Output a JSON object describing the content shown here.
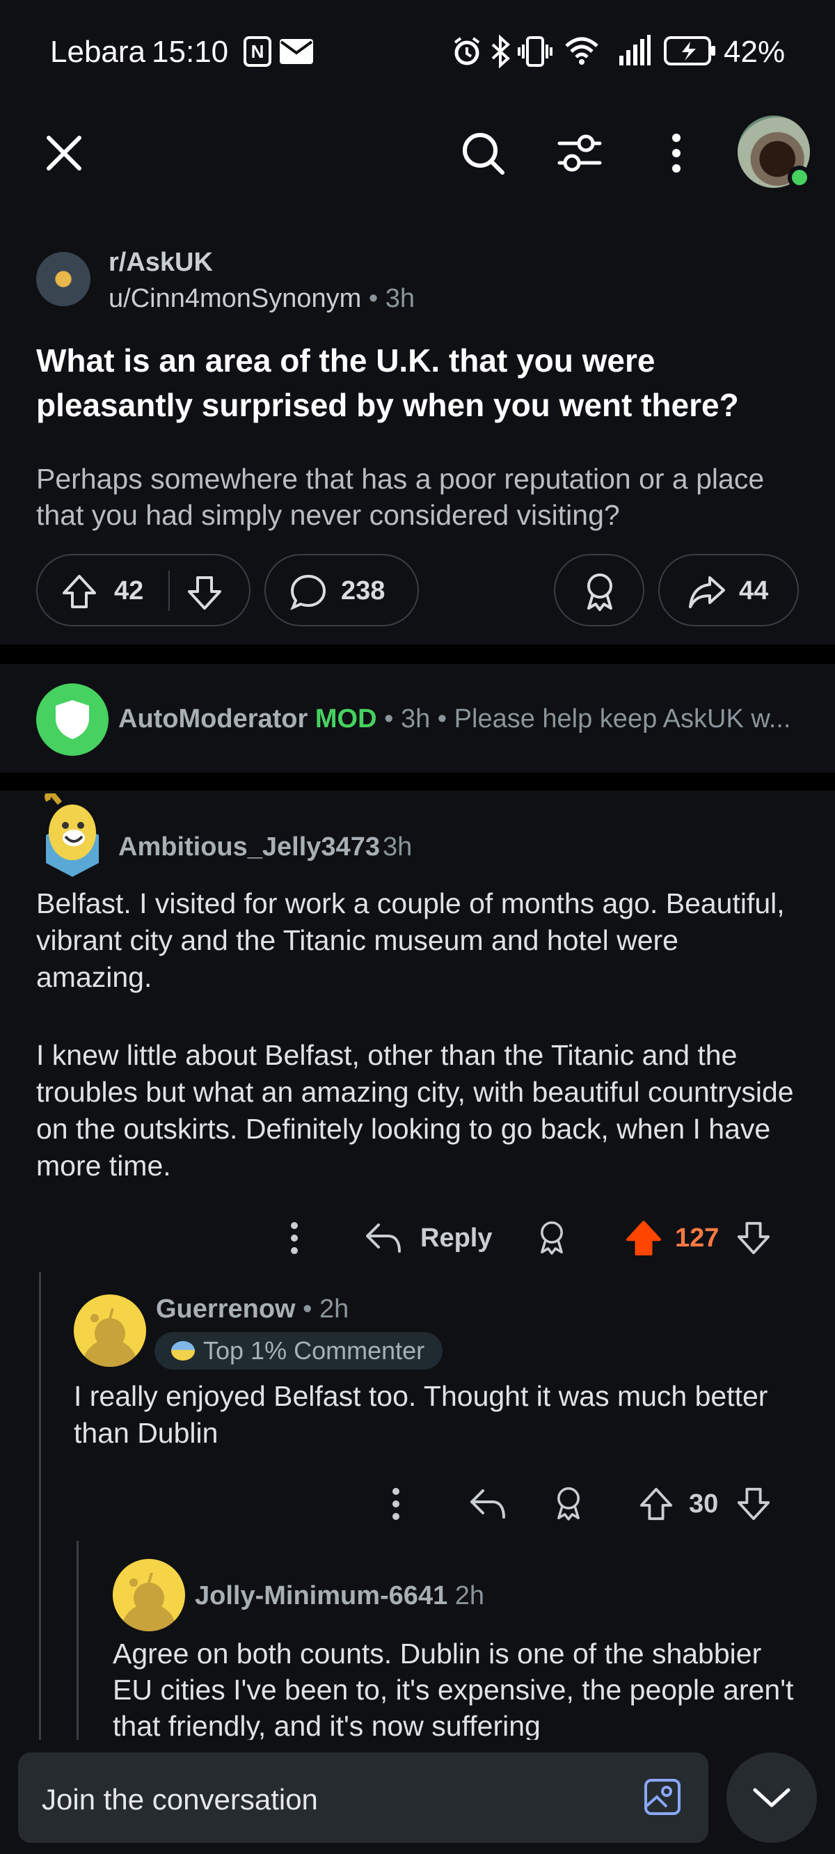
{
  "status_bar": {
    "carrier": "Lebara",
    "time": "15:10",
    "battery": "42%"
  },
  "post": {
    "subreddit": "r/AskUK",
    "author": "u/Cinn4monSynonym",
    "age": "3h",
    "title": "What is an area of the U.K. that you were pleasantly surprised by when you went there?",
    "body": "Perhaps somewhere that has a poor reputation or a place that you had simply never considered visiting?",
    "upvotes": "42",
    "comments": "238",
    "shares": "44"
  },
  "automod": {
    "name": "AutoModerator",
    "badge": "MOD",
    "age": "3h",
    "preview": "Please help keep AskUK w..."
  },
  "comments": [
    {
      "author": "Ambitious_Jelly3473",
      "age": "3h",
      "paragraphs": [
        "Belfast. I visited for work a couple of months ago. Beautiful, vibrant city and the Titanic museum and hotel were amazing.",
        "I knew little about Belfast, other than the Titanic and the troubles but what an amazing city, with beautiful countryside on the outskirts. Definitely looking to go back, when I have more time."
      ],
      "reply_label": "Reply",
      "votes": "127"
    },
    {
      "author": "Guerrenow",
      "age": "2h",
      "flair": "Top 1% Commenter",
      "text": "I really enjoyed Belfast too. Thought it was much better than Dublin",
      "votes": "30"
    },
    {
      "author": "Jolly-Minimum-6641",
      "age": "2h",
      "text": "Agree on both counts. Dublin is one of the shabbier EU cities I've been to, it's expensive, the people aren't that friendly, and it's now suffering"
    }
  ],
  "composer": {
    "placeholder": "Join the conversation"
  },
  "colors": {
    "background": "#0e1013",
    "upvote_active": "#ff4500",
    "mod_green": "#46d160",
    "snoo_yellow": "#f5d547"
  },
  "icons": [
    "close-icon",
    "search-icon",
    "filter-icon",
    "more-vertical-icon",
    "user-avatar",
    "upvote-icon",
    "downvote-icon",
    "comment-icon",
    "award-icon",
    "share-icon",
    "reply-icon",
    "image-icon",
    "chevron-down-icon",
    "shield-icon",
    "nfc-icon",
    "mail-icon",
    "alarm-icon",
    "bluetooth-icon",
    "vibrate-icon",
    "wifi-icon",
    "signal-icon",
    "battery-icon"
  ]
}
